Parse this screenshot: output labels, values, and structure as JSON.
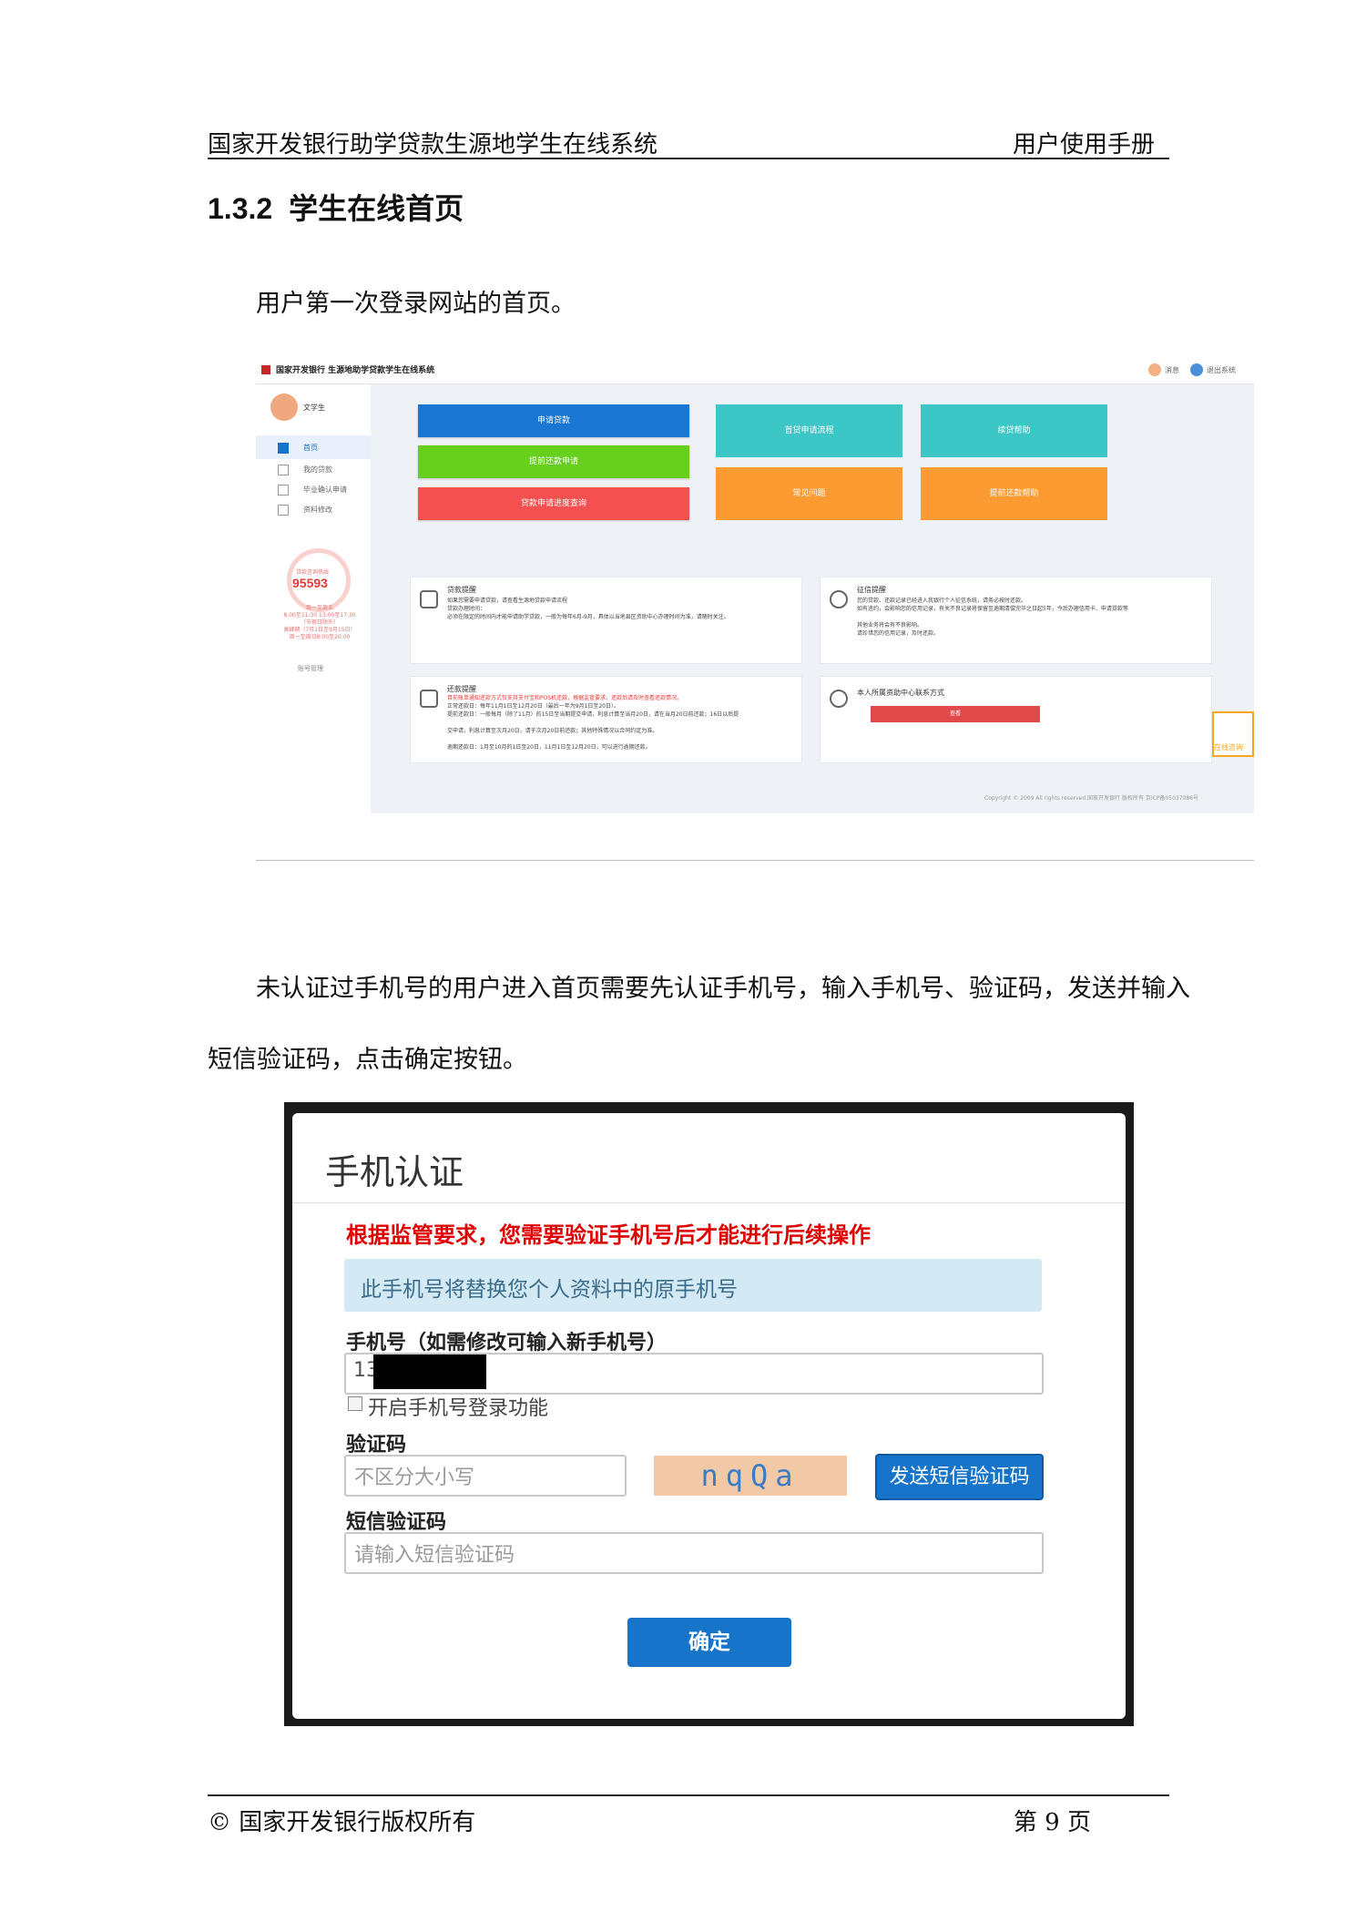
{
  "header": {
    "left": "国家开发银行助学贷款生源地学生在线系统",
    "right": "用户使用手册"
  },
  "section": {
    "number": "1.3.2",
    "title": "学生在线首页"
  },
  "para1": "用户第一次登录网站的首页。",
  "para2_line1": "未认证过手机号的用户进入首页需要先认证手机号，输入手机号、验证码，发送并输入",
  "para2_line2": "短信验证码，点击确定按钮。",
  "screenshot1": {
    "brand": "国家开发银行 生源地助学贷款学生在线系统",
    "top_links": [
      "消息",
      "退出系统"
    ],
    "user_name": "文学生",
    "nav": [
      "首页",
      "我的贷款",
      "毕业确认申请",
      "资料修改"
    ],
    "hotline_label": "贷款咨询热线",
    "hotline": "95593",
    "hours": [
      "周一至周五",
      "8:00至11:30 13:00至17:30",
      "（节假日除外）",
      "高峰期（7月1日至9月15日）",
      "周一至周日8:00至20:00"
    ],
    "manager_link": "账号管理",
    "buttons": [
      "申请贷款",
      "提前还款申请",
      "贷款申请进度查询"
    ],
    "tiles": [
      "首贷申请流程",
      "续贷帮助",
      "常见问题",
      "提前还款帮助"
    ],
    "card_loan": {
      "title": "贷款提醒",
      "lines": [
        "如果您需要申请贷款，请查看生源地贷款申请流程",
        "贷款办理时间：",
        "必须在限定的时间内才能申请助学贷款，一般为每年6月-9月，具体以当地县区资助中心办理时间为准，请随时关注。"
      ]
    },
    "card_credit": {
      "title": "征信提醒",
      "lines": [
        "您的贷款、还款记录已经进入我银行个人征信系统，请务必按时还款。",
        "如有违约，会影响您的信用记录，有关不良记录将保留至逾期清偿完毕之日起5年，今后办理信用卡、申请贷款等",
        "其他业务将会有不良影响。",
        "请珍惜您的信用记录，及时还款。"
      ]
    },
    "card_repay": {
      "title": "还款提醒",
      "lines": [
        "目前账单通知还款方式仅支持支付宝和POS机还款，根据监管要求，还款后请及时查看还款情况。",
        "正常还款日：每年11月1日至12月20日（最后一年为9月1日至20日）。",
        "提前还款日：一般每月（除了11月）的15日至当期提交申请，利息计算至当月20日，请在当月20日前还款；16日以后提",
        "交申请，利息计算至次月20日，请于次月20日前还款；其他特殊情况以合同约定为准。",
        "逾期还款日：1月至10月的1日至20日，11月1日至12月20日，可以进行逾期还款。"
      ]
    },
    "card_contact": {
      "title": "本人所属资助中心联系方式",
      "button": "查看"
    },
    "customer_service": "在线咨询",
    "copyright": "Copyright © 2009 All rights reserved.国家开发银行 版权所有 京ICP备05037086号"
  },
  "modal": {
    "title": "手机认证",
    "warning": "根据监管要求，您需要验证手机号后才能进行后续操作",
    "info": "此手机号将替换您个人资料中的原手机号",
    "phone_label": "手机号（如需修改可输入新手机号）",
    "phone_value": "13",
    "checkbox_label": "开启手机号登录功能",
    "captcha_label": "验证码",
    "captcha_placeholder": "不区分大小写",
    "captcha_image_text": "nqQa",
    "send_button": "发送短信验证码",
    "sms_label": "短信验证码",
    "sms_placeholder": "请输入短信验证码",
    "confirm_button": "确定"
  },
  "footer": {
    "left": "©  国家开发银行版权所有",
    "right": "第 9 页"
  }
}
